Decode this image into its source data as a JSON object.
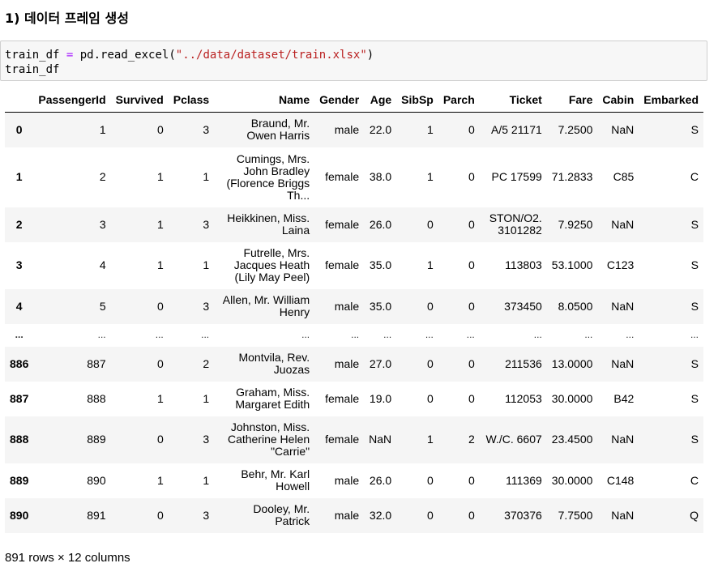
{
  "heading": "1) 데이터 프레임 생성",
  "code": {
    "var": "train_df",
    "op": "=",
    "call": "pd.read_excel(",
    "arg": "\"../data/dataset/train.xlsx\"",
    "close": ")",
    "line2": "train_df"
  },
  "table": {
    "columns": [
      "",
      "PassengerId",
      "Survived",
      "Pclass",
      "Name",
      "Gender",
      "Age",
      "SibSp",
      "Parch",
      "Ticket",
      "Fare",
      "Cabin",
      "Embarked"
    ],
    "rows": [
      {
        "idx": "0",
        "cells": [
          "1",
          "0",
          "3",
          "Braund, Mr. Owen Harris",
          "male",
          "22.0",
          "1",
          "0",
          "A/5 21171",
          "7.2500",
          "NaN",
          "S"
        ]
      },
      {
        "idx": "1",
        "cells": [
          "2",
          "1",
          "1",
          "Cumings, Mrs. John Bradley (Florence Briggs Th...",
          "female",
          "38.0",
          "1",
          "0",
          "PC 17599",
          "71.2833",
          "C85",
          "C"
        ]
      },
      {
        "idx": "2",
        "cells": [
          "3",
          "1",
          "3",
          "Heikkinen, Miss. Laina",
          "female",
          "26.0",
          "0",
          "0",
          "STON/O2. 3101282",
          "7.9250",
          "NaN",
          "S"
        ]
      },
      {
        "idx": "3",
        "cells": [
          "4",
          "1",
          "1",
          "Futrelle, Mrs. Jacques Heath (Lily May Peel)",
          "female",
          "35.0",
          "1",
          "0",
          "113803",
          "53.1000",
          "C123",
          "S"
        ]
      },
      {
        "idx": "4",
        "cells": [
          "5",
          "0",
          "3",
          "Allen, Mr. William Henry",
          "male",
          "35.0",
          "0",
          "0",
          "373450",
          "8.0500",
          "NaN",
          "S"
        ]
      },
      {
        "idx": "...",
        "cells": [
          "...",
          "...",
          "...",
          "...",
          "...",
          "...",
          "...",
          "...",
          "...",
          "...",
          "...",
          "..."
        ]
      },
      {
        "idx": "886",
        "cells": [
          "887",
          "0",
          "2",
          "Montvila, Rev. Juozas",
          "male",
          "27.0",
          "0",
          "0",
          "211536",
          "13.0000",
          "NaN",
          "S"
        ]
      },
      {
        "idx": "887",
        "cells": [
          "888",
          "1",
          "1",
          "Graham, Miss. Margaret Edith",
          "female",
          "19.0",
          "0",
          "0",
          "112053",
          "30.0000",
          "B42",
          "S"
        ]
      },
      {
        "idx": "888",
        "cells": [
          "889",
          "0",
          "3",
          "Johnston, Miss. Catherine Helen \"Carrie\"",
          "female",
          "NaN",
          "1",
          "2",
          "W./C. 6607",
          "23.4500",
          "NaN",
          "S"
        ]
      },
      {
        "idx": "889",
        "cells": [
          "890",
          "1",
          "1",
          "Behr, Mr. Karl Howell",
          "male",
          "26.0",
          "0",
          "0",
          "111369",
          "30.0000",
          "C148",
          "C"
        ]
      },
      {
        "idx": "890",
        "cells": [
          "891",
          "0",
          "3",
          "Dooley, Mr. Patrick",
          "male",
          "32.0",
          "0",
          "0",
          "370376",
          "7.7500",
          "NaN",
          "Q"
        ]
      }
    ]
  },
  "footer": "891 rows × 12 columns"
}
